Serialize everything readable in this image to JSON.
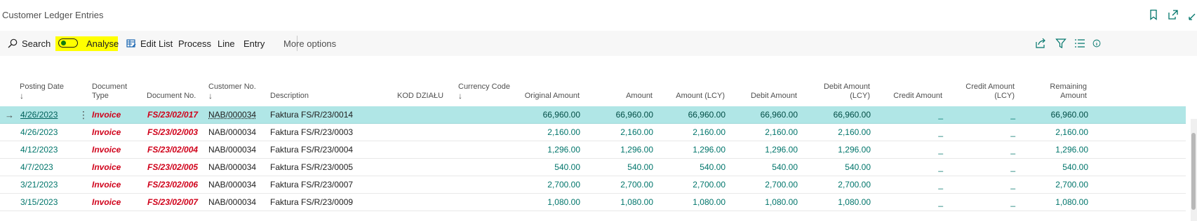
{
  "page": {
    "title": "Customer Ledger Entries"
  },
  "header_icons": [
    "bookmark-icon",
    "open-new-window-icon",
    "collapse-icon"
  ],
  "action_bar": {
    "search_label": "Search",
    "analyse_label": "Analyse",
    "edit_list_label": "Edit List",
    "process_label": "Process",
    "line_label": "Line",
    "entry_label": "Entry",
    "more_options_label": "More options",
    "right_icons": [
      "share-icon",
      "filter-icon",
      "list-view-icon",
      "info-icon"
    ]
  },
  "columns": {
    "posting_date": "Posting Date",
    "document_type_1": "Document",
    "document_type_2": "Type",
    "document_no": "Document No.",
    "customer_no": "Customer No.",
    "description": "Description",
    "kod_dzialu": "KOD DZIAŁU",
    "currency_code": "Currency Code",
    "original_amount": "Original Amount",
    "amount": "Amount",
    "amount_lcy": "Amount (LCY)",
    "debit_amount": "Debit Amount",
    "debit_amount_lcy_1": "Debit Amount",
    "debit_amount_lcy_2": "(LCY)",
    "credit_amount": "Credit Amount",
    "credit_amount_lcy_1": "Credit Amount",
    "credit_amount_lcy_2": "(LCY)",
    "remaining_amount_1": "Remaining",
    "remaining_amount_2": "Amount",
    "sort_arrow": "↓"
  },
  "rows": [
    {
      "posting_date": "4/26/2023",
      "document_type": "Invoice",
      "document_no": "FS/23/02/017",
      "customer_no": "NAB/000034",
      "description": "Faktura FS/R/23/0014",
      "original_amount": "66,960.00",
      "amount": "66,960.00",
      "amount_lcy": "66,960.00",
      "debit_amount": "66,960.00",
      "debit_amount_lcy": "66,960.00",
      "credit_amount": "_",
      "credit_amount_lcy": "_",
      "remaining_amount": "66,960.00"
    },
    {
      "posting_date": "4/26/2023",
      "document_type": "Invoice",
      "document_no": "FS/23/02/003",
      "customer_no": "NAB/000034",
      "description": "Faktura FS/R/23/0003",
      "original_amount": "2,160.00",
      "amount": "2,160.00",
      "amount_lcy": "2,160.00",
      "debit_amount": "2,160.00",
      "debit_amount_lcy": "2,160.00",
      "credit_amount": "_",
      "credit_amount_lcy": "_",
      "remaining_amount": "2,160.00"
    },
    {
      "posting_date": "4/12/2023",
      "document_type": "Invoice",
      "document_no": "FS/23/02/004",
      "customer_no": "NAB/000034",
      "description": "Faktura FS/R/23/0004",
      "original_amount": "1,296.00",
      "amount": "1,296.00",
      "amount_lcy": "1,296.00",
      "debit_amount": "1,296.00",
      "debit_amount_lcy": "1,296.00",
      "credit_amount": "_",
      "credit_amount_lcy": "_",
      "remaining_amount": "1,296.00"
    },
    {
      "posting_date": "4/7/2023",
      "document_type": "Invoice",
      "document_no": "FS/23/02/005",
      "customer_no": "NAB/000034",
      "description": "Faktura FS/R/23/0005",
      "original_amount": "540.00",
      "amount": "540.00",
      "amount_lcy": "540.00",
      "debit_amount": "540.00",
      "debit_amount_lcy": "540.00",
      "credit_amount": "_",
      "credit_amount_lcy": "_",
      "remaining_amount": "540.00"
    },
    {
      "posting_date": "3/21/2023",
      "document_type": "Invoice",
      "document_no": "FS/23/02/006",
      "customer_no": "NAB/000034",
      "description": "Faktura FS/R/23/0007",
      "original_amount": "2,700.00",
      "amount": "2,700.00",
      "amount_lcy": "2,700.00",
      "debit_amount": "2,700.00",
      "debit_amount_lcy": "2,700.00",
      "credit_amount": "_",
      "credit_amount_lcy": "_",
      "remaining_amount": "2,700.00"
    },
    {
      "posting_date": "3/15/2023",
      "document_type": "Invoice",
      "document_no": "FS/23/02/007",
      "customer_no": "NAB/000034",
      "description": "Faktura FS/R/23/0009",
      "original_amount": "1,080.00",
      "amount": "1,080.00",
      "amount_lcy": "1,080.00",
      "debit_amount": "1,080.00",
      "debit_amount_lcy": "1,080.00",
      "credit_amount": "_",
      "credit_amount_lcy": "_",
      "remaining_amount": "1,080.00"
    }
  ],
  "colors": {
    "accent": "#00756b",
    "selected_row": "#b0e6e6",
    "document_red": "#d0021b",
    "highlight_yellow": "#ffff00"
  }
}
